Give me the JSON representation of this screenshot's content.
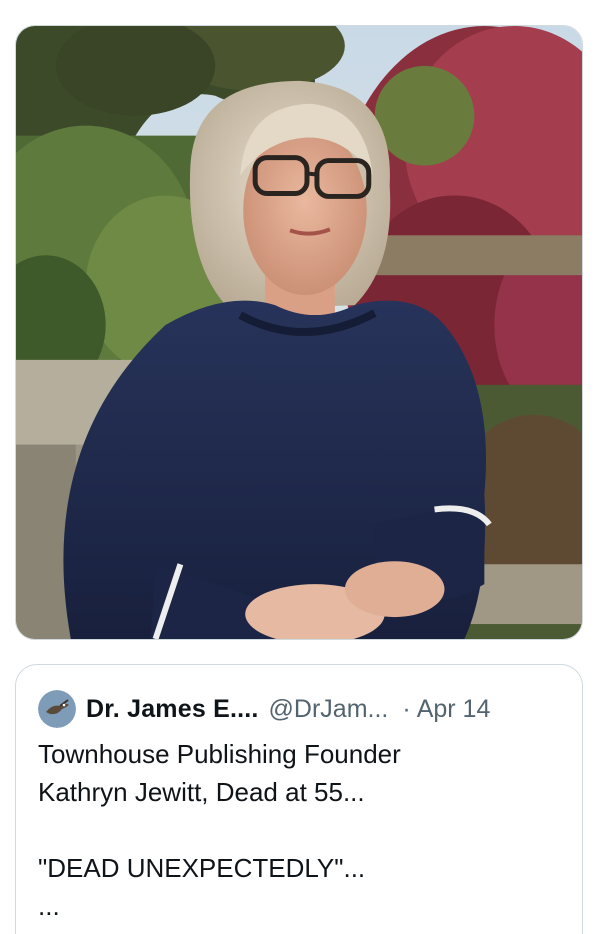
{
  "media": {
    "photo_alt": ""
  },
  "quoted_tweet": {
    "author_name": "Dr. James E....",
    "author_handle": "@DrJam...",
    "separator": "·",
    "date": "Apr 14",
    "text_lines": [
      "Townhouse Publishing Founder",
      "Kathryn Jewitt, Dead at 55...",
      "",
      "\"DEAD UNEXPECTEDLY\"...",
      "..."
    ]
  },
  "icons": {
    "avatar": "bird-avatar-icon"
  },
  "colors": {
    "border": "#cfd9de",
    "primary_text": "#0f1419",
    "secondary_text": "#536471",
    "sweater": "#1f2a4a"
  }
}
